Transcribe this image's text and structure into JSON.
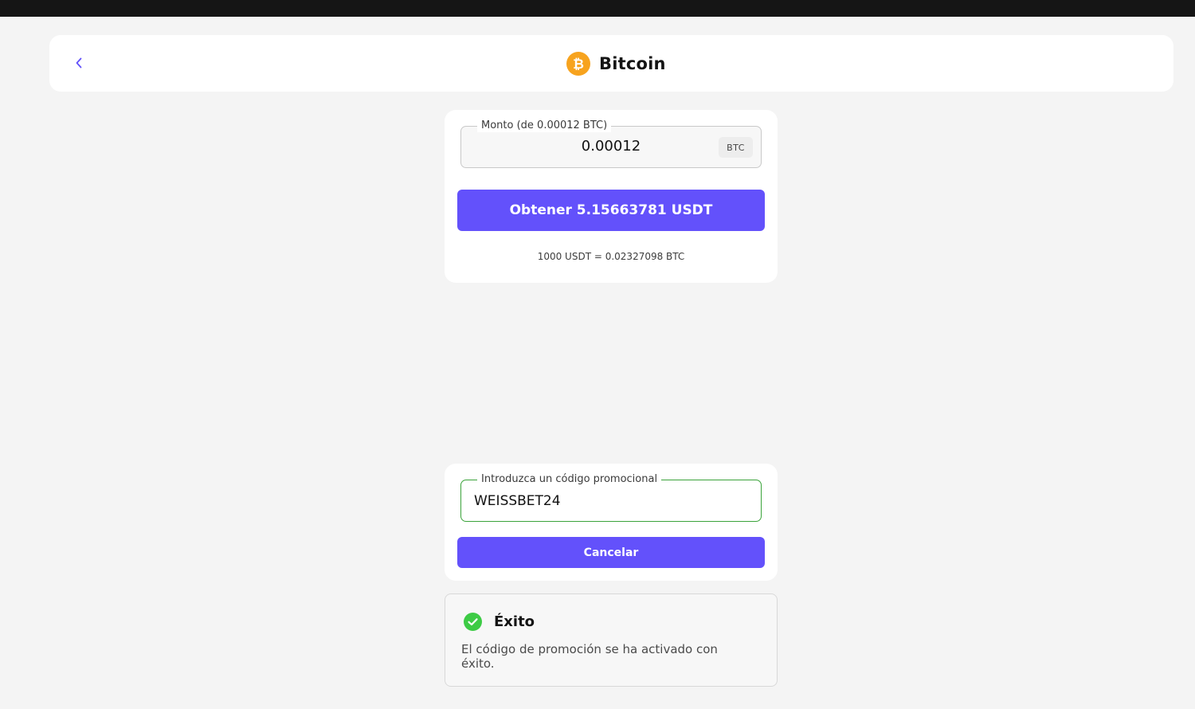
{
  "header": {
    "title": "Bitcoin",
    "back_icon": "chevron-left-icon",
    "coin_icon": "bitcoin-icon",
    "coin_color": "#F7A31E"
  },
  "amount_card": {
    "legend": "Monto (de 0.00012 BTC)",
    "value": "0.00012",
    "unit": "BTC",
    "obtain_label": "Obtener 5.15663781 USDT",
    "rate": "1000 USDT = 0.02327098 BTC"
  },
  "promo_card": {
    "legend": "Introduzca un código promocional",
    "value": "WEISSBET24",
    "cancel_label": "Cancelar"
  },
  "toast": {
    "title": "Éxito",
    "message": "El código de promoción se ha activado con éxito.",
    "icon": "check-circle-icon",
    "success_color": "#3DCB45"
  },
  "colors": {
    "accent": "#6351FB",
    "background": "#F4F4F4",
    "success_border": "#3AA33A"
  }
}
